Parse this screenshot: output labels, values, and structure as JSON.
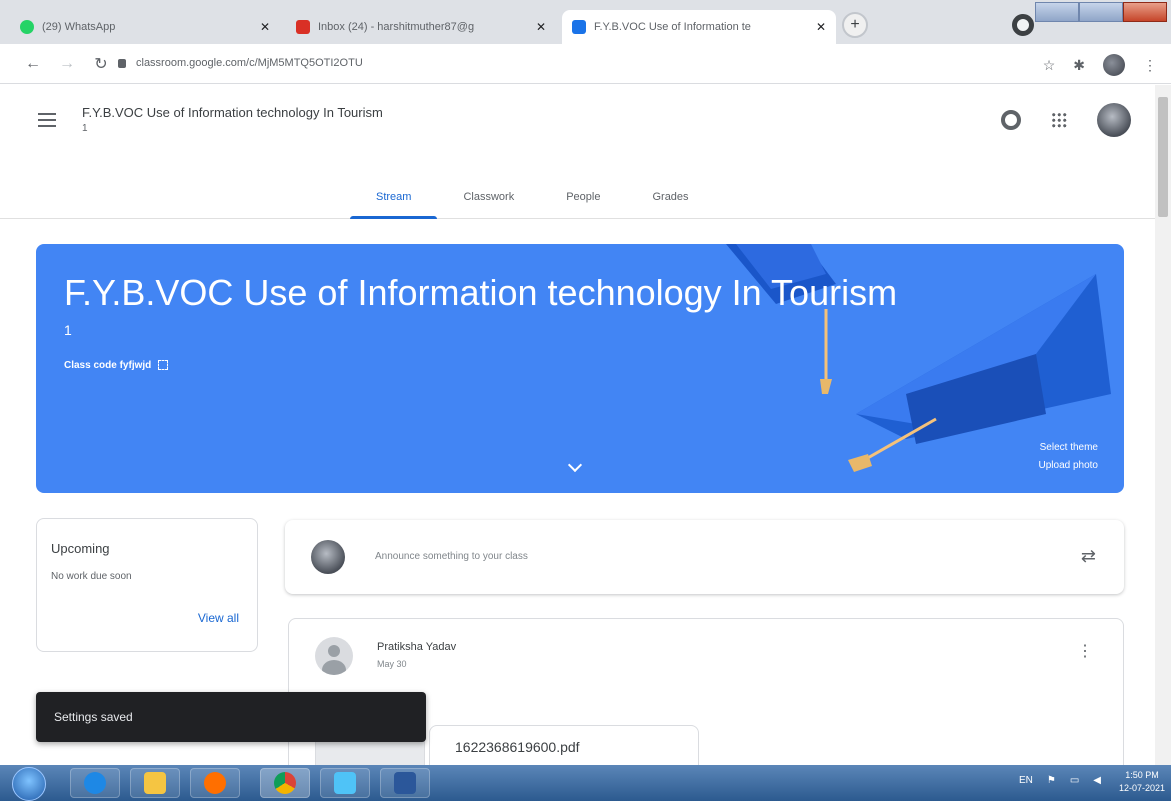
{
  "browser": {
    "tabs": [
      {
        "title": "(29) WhatsApp",
        "favicon_color": "#25d366"
      },
      {
        "title": "Inbox (24) - harshitmuther87@g",
        "favicon_color": "#d93025"
      },
      {
        "title": "F.Y.B.VOC Use of Information te",
        "favicon_color": "#1a73e8"
      }
    ],
    "url": "classroom.google.com/c/MjM5MTQ5OTI2OTU"
  },
  "classroom": {
    "header_title": "F.Y.B.VOC Use of Information technology In Tourism",
    "header_section": "1",
    "tabs": [
      "Stream",
      "Classwork",
      "People",
      "Grades"
    ],
    "active_tab": "Stream"
  },
  "banner": {
    "title": "F.Y.B.VOC Use of Information technology In Tourism",
    "section": "1",
    "class_code_label": "Class code",
    "class_code": "fyfjwjd",
    "select_theme": "Select theme",
    "upload_photo": "Upload photo",
    "color": "#4285f4"
  },
  "upcoming": {
    "title": "Upcoming",
    "subtitle": "No work due soon",
    "view_all": "View all"
  },
  "announce": {
    "placeholder": "Announce something to your class"
  },
  "post": {
    "author": "Pratiksha Yadav",
    "date": "May 30",
    "attachment_name": "1622368619600.pdf"
  },
  "snackbar": {
    "message": "Settings saved"
  },
  "taskbar": {
    "language": "EN",
    "time": "1:50 PM",
    "date": "12-07-2021"
  }
}
